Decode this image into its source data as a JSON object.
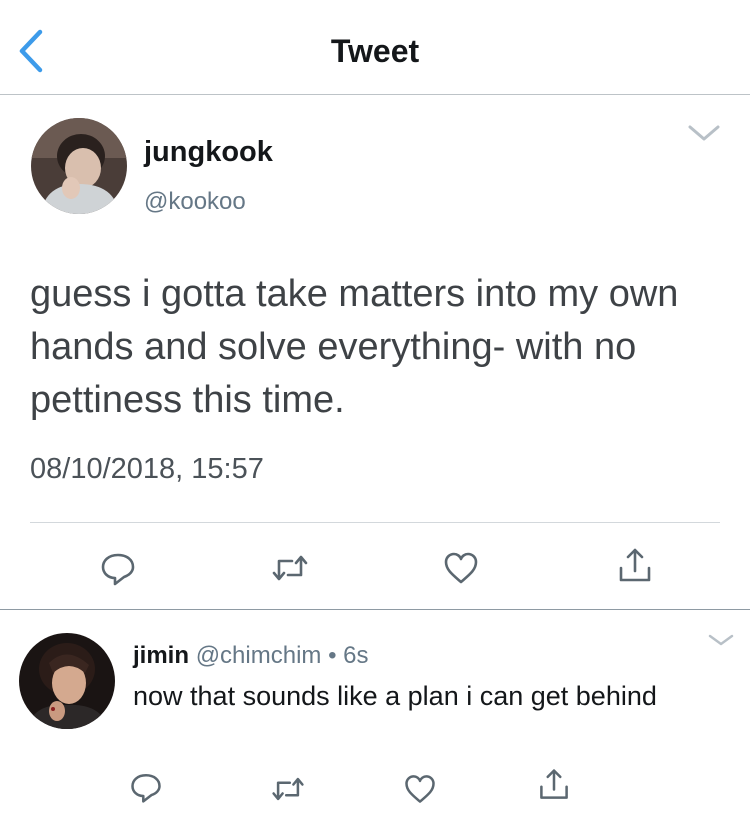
{
  "header": {
    "title": "Tweet",
    "back_icon": "chevron-left-icon",
    "accent": "#3d9bea"
  },
  "main_tweet": {
    "display_name": "jungkook",
    "handle": "@kookoo",
    "text": "guess i gotta take matters into my own hands and solve everything- with no pettiness this time.",
    "timestamp": "08/10/2018, 15:57",
    "menu_icon": "chevron-down-icon",
    "actions": [
      "reply-icon",
      "retweet-icon",
      "like-icon",
      "share-icon"
    ]
  },
  "reply_tweet": {
    "display_name": "jimin",
    "handle": "@chimchim",
    "separator": "•",
    "age": "6s",
    "text": "now that sounds like a plan i can get behind",
    "menu_icon": "chevron-down-icon",
    "actions": [
      "reply-icon",
      "retweet-icon",
      "like-icon",
      "share-icon"
    ]
  },
  "colors": {
    "icon": "#5b6770",
    "secondary_text": "#657786"
  }
}
